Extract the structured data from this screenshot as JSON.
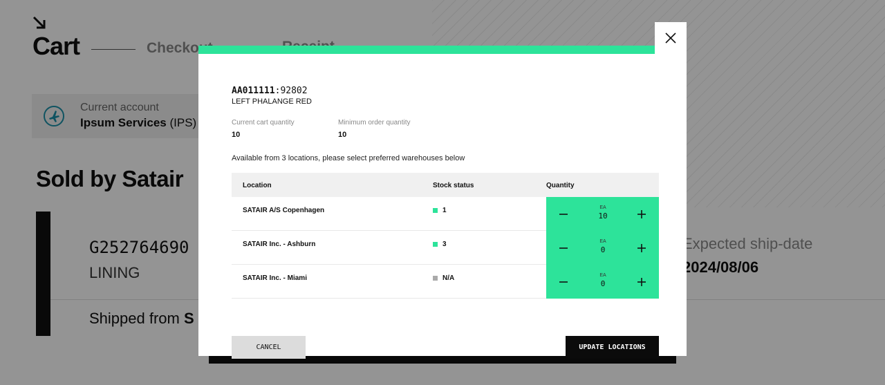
{
  "background": {
    "cart_title": "Cart",
    "steps": {
      "checkout": "Checkout",
      "receipt": "Receipt"
    },
    "account": {
      "label": "Current account",
      "name": "Ipsum Services",
      "code": "(IPS)"
    },
    "sold_by": "Sold by Satair",
    "line": {
      "part_number": "G252764690",
      "description": "LINING",
      "shipped_from_label": "Shipped from",
      "shipped_from_value": "S",
      "ship_date_label": "Expected ship-date",
      "ship_date": "2024/08/06"
    }
  },
  "modal": {
    "part_code": "AA011111",
    "part_suffix": ":92802",
    "part_description": "LEFT PHALANGE RED",
    "current_qty_label": "Current cart quantity",
    "current_qty": "10",
    "min_qty_label": "Minimum order quantity",
    "min_qty": "10",
    "available_text": "Available from 3 locations, please select preferred warehouses below",
    "table": {
      "headers": {
        "location": "Location",
        "stock": "Stock status",
        "quantity": "Quantity"
      },
      "rows": [
        {
          "location": "SATAIR A/S Copenhagen",
          "stock": "1",
          "stock_color": "#2de39a",
          "unit": "EA",
          "qty": "10"
        },
        {
          "location": "SATAIR Inc. - Ashburn",
          "stock": "3",
          "stock_color": "#2de39a",
          "unit": "EA",
          "qty": "0"
        },
        {
          "location": "SATAIR Inc. - Miami",
          "stock": "N/A",
          "stock_color": "#aaaaaa",
          "unit": "EA",
          "qty": "0"
        }
      ]
    },
    "cancel_label": "CANCEL",
    "update_label": "UPDATE LOCATIONS"
  },
  "colors": {
    "accent": "#2de39a",
    "na": "#aaaaaa",
    "primary_button": "#0b0b0b"
  }
}
